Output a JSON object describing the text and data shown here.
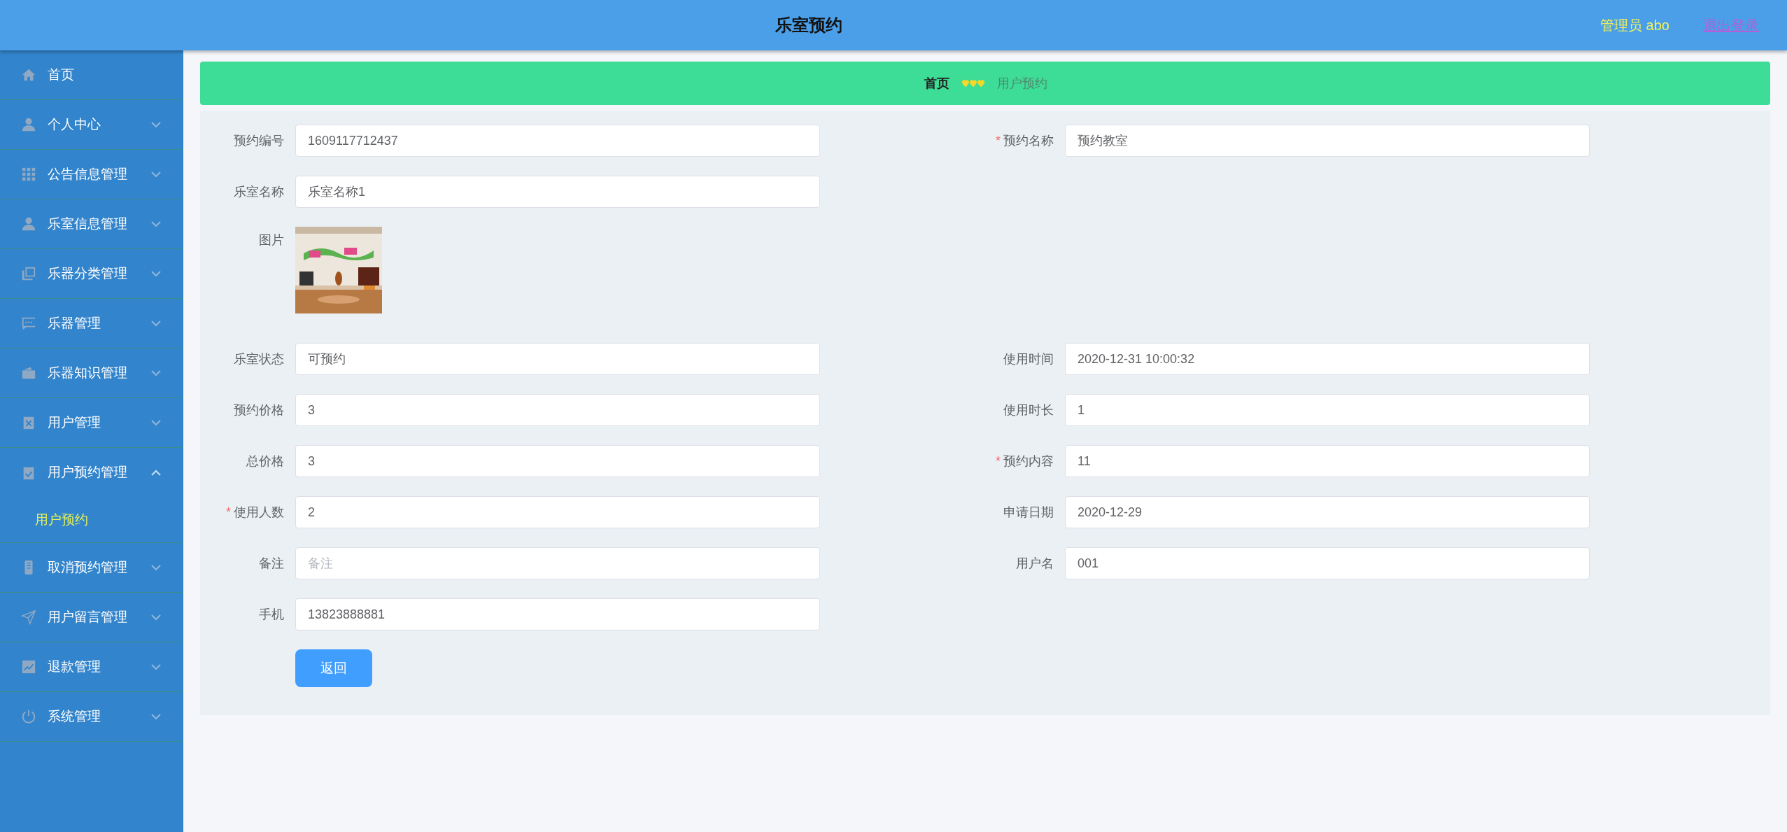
{
  "header": {
    "title": "乐室预约",
    "user": "管理员 abo",
    "logout": "退出登录"
  },
  "sidebar": {
    "items": [
      {
        "label": "首页",
        "kind": "link"
      },
      {
        "label": "个人中心",
        "kind": "menu",
        "expanded": false
      },
      {
        "label": "公告信息管理",
        "kind": "menu",
        "expanded": false
      },
      {
        "label": "乐室信息管理",
        "kind": "menu",
        "expanded": false
      },
      {
        "label": "乐器分类管理",
        "kind": "menu",
        "expanded": false
      },
      {
        "label": "乐器管理",
        "kind": "menu",
        "expanded": false
      },
      {
        "label": "乐器知识管理",
        "kind": "menu",
        "expanded": false
      },
      {
        "label": "用户管理",
        "kind": "menu",
        "expanded": false
      },
      {
        "label": "用户预约管理",
        "kind": "menu",
        "expanded": true,
        "children": [
          {
            "label": "用户预约",
            "selected": true
          }
        ]
      },
      {
        "label": "取消预约管理",
        "kind": "menu",
        "expanded": false
      },
      {
        "label": "用户留言管理",
        "kind": "menu",
        "expanded": false
      },
      {
        "label": "退款管理",
        "kind": "menu",
        "expanded": false
      },
      {
        "label": "系统管理",
        "kind": "menu",
        "expanded": false
      }
    ]
  },
  "breadcrumb": [
    {
      "label": "首页",
      "selected": true
    },
    {
      "label": "用户预约",
      "selected": false
    }
  ],
  "form": {
    "rows": [
      [
        {
          "kind": "text",
          "label": "预约编号",
          "value": "1609117712437"
        },
        {
          "kind": "text",
          "required_mark": "*",
          "label": "预约名称",
          "value": "预约教室"
        }
      ],
      [
        {
          "kind": "text",
          "label": "乐室名称",
          "value": "乐室名称1"
        }
      ],
      [
        {
          "label": "图片"
        }
      ],
      [
        {
          "kind": "text",
          "label": "乐室状态",
          "value": "可预约"
        },
        {
          "kind": "text",
          "label": "使用时间",
          "value": "2020-12-31 10:00:32"
        }
      ],
      [
        {
          "kind": "text",
          "label": "预约价格",
          "value": "3"
        },
        {
          "kind": "text",
          "label": "使用时长",
          "value": "1"
        }
      ],
      [
        {
          "kind": "text",
          "label": "总价格",
          "value": "3"
        },
        {
          "kind": "text",
          "required_mark": "*",
          "label": "预约内容",
          "value": "11"
        }
      ],
      [
        {
          "kind": "text",
          "required_mark": "*",
          "label": "使用人数",
          "value": "2"
        },
        {
          "kind": "text",
          "label": "申请日期",
          "value": "2020-12-29"
        }
      ],
      [
        {
          "kind": "text",
          "label": "备注",
          "placeholder": "备注"
        },
        {
          "kind": "text",
          "label": "用户名",
          "value": "001"
        }
      ],
      [
        {
          "kind": "text",
          "label": "手机",
          "value": "13823888881"
        }
      ]
    ],
    "button": "返回"
  }
}
